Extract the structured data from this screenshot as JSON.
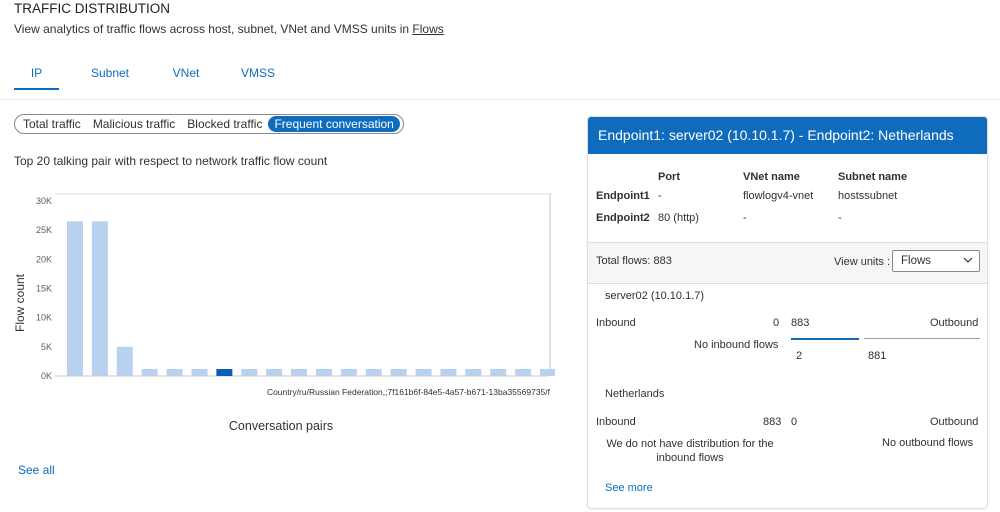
{
  "header": {
    "title": "TRAFFIC DISTRIBUTION",
    "subtitle": "View analytics of traffic flows across host, subnet, VNet and VMSS units in",
    "subtitle_link": "Flows"
  },
  "tabs": [
    {
      "label": "IP",
      "active": true
    },
    {
      "label": "Subnet",
      "active": false
    },
    {
      "label": "VNet",
      "active": false
    },
    {
      "label": "VMSS",
      "active": false
    }
  ],
  "filters": [
    {
      "label": "Total traffic",
      "selected": false
    },
    {
      "label": "Malicious traffic",
      "selected": false
    },
    {
      "label": "Blocked traffic",
      "selected": false
    },
    {
      "label": "Frequent conversation",
      "selected": true
    }
  ],
  "chart_description": "Top 20 talking pair with respect to network traffic flow count",
  "chart_data": {
    "type": "bar",
    "ylabel": "Flow count",
    "xlabel": "Conversation pairs",
    "ylim": [
      0,
      30000
    ],
    "yticks": [
      "0K",
      "5K",
      "10K",
      "15K",
      "20K",
      "25K",
      "30K"
    ],
    "highlight_index": 6,
    "highlight_label": "Country/ru/Russian Federation,;7f161b6f-84e5-4a57-b671-13ba35569735/f",
    "values": [
      26500,
      26500,
      5000,
      1200,
      1200,
      1200,
      1200,
      1200,
      1200,
      1200,
      1200,
      1200,
      1200,
      1200,
      1200,
      1200,
      1200,
      1200,
      1200,
      1200
    ],
    "bar_color": "#b7d1ee",
    "highlight_color": "#0f5db3"
  },
  "see_all": "See all",
  "card": {
    "title": "Endpoint1: server02 (10.10.1.7) - Endpoint2: Netherlands",
    "columns": [
      "Port",
      "VNet name",
      "Subnet name"
    ],
    "rows": [
      {
        "label": "Endpoint1",
        "port": "-",
        "vnet": "flowlogv4-vnet",
        "subnet": "hostssubnet"
      },
      {
        "label": "Endpoint2",
        "port": "80 (http)",
        "vnet": "-",
        "subnet": "-"
      }
    ],
    "total_flows": "Total flows: 883",
    "view_units_label": "View units :",
    "view_units_value": "Flows",
    "host": {
      "name": "server02 (10.10.1.7)",
      "inbound_label": "Inbound",
      "inbound_value": "0",
      "inbound_total": "883",
      "outbound_label": "Outbound",
      "inbound_note": "No inbound flows",
      "out_a": "2",
      "out_b": "881"
    },
    "country": {
      "name": "Netherlands",
      "inbound_label": "Inbound",
      "inbound_value": "883",
      "outbound_value": "0",
      "outbound_label": "Outbound",
      "inbound_note": "We do not have distribution for the inbound flows",
      "outbound_note": "No outbound flows"
    },
    "see_more": "See more"
  },
  "colors": {
    "accent": "#0f6cbd"
  }
}
